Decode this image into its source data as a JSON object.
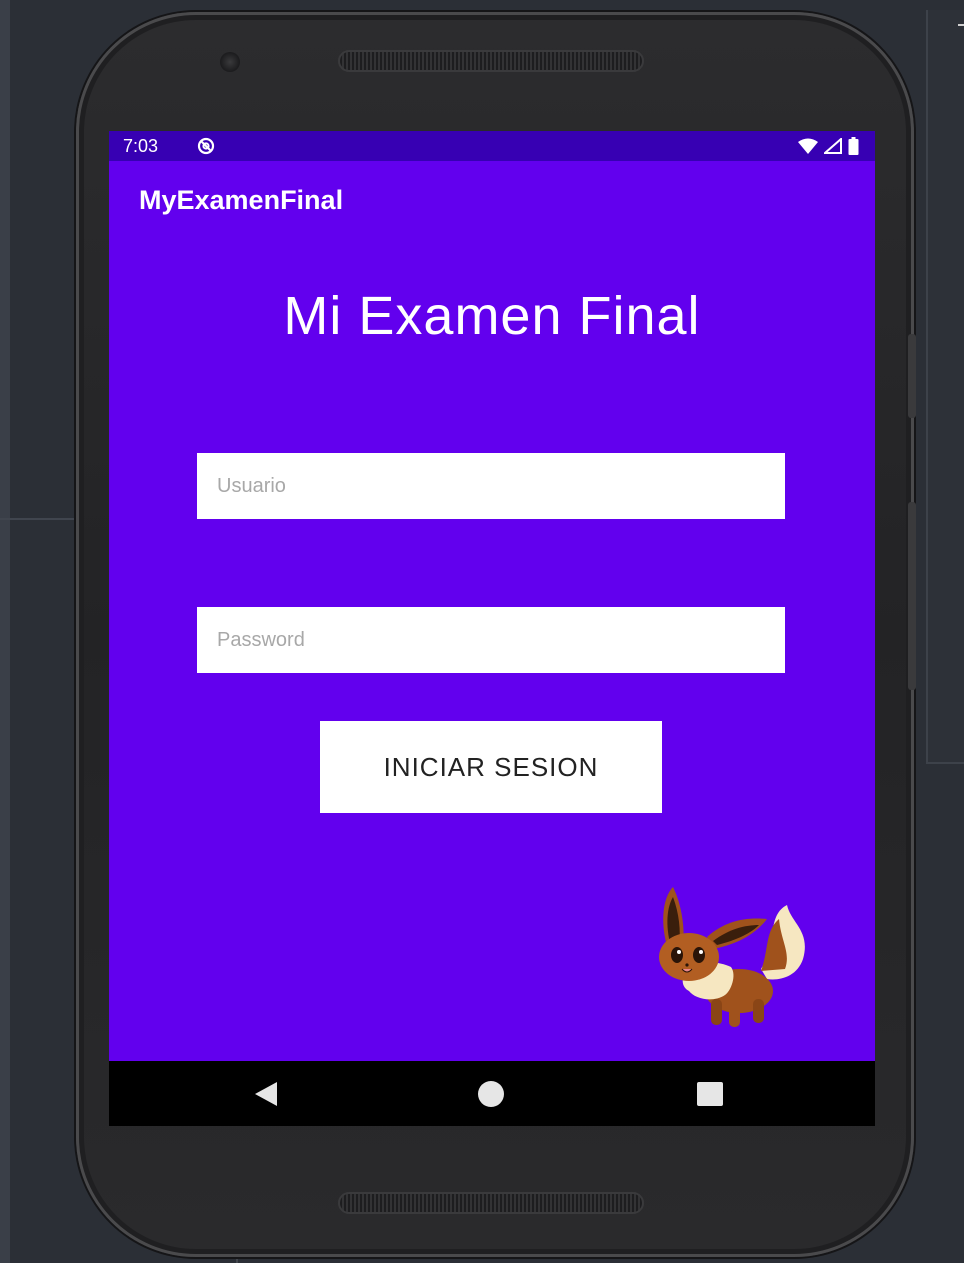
{
  "status_bar": {
    "time": "7:03",
    "sync_icon": "sync-disabled-icon",
    "icons": [
      "wifi-icon",
      "signal-icon",
      "battery-icon"
    ]
  },
  "app_bar": {
    "title": "MyExamenFinal"
  },
  "main": {
    "headline": "Mi Examen Final",
    "username_placeholder": "Usuario",
    "password_placeholder": "Password",
    "login_button": "INICIAR SESION",
    "mascot": "eevee-image"
  },
  "nav_bar": {
    "back": "back-icon",
    "home": "home-icon",
    "recents": "recents-icon"
  },
  "colors": {
    "primary": "#6200ee",
    "primary_dark": "#3700b3",
    "nav_bar": "#000000"
  }
}
